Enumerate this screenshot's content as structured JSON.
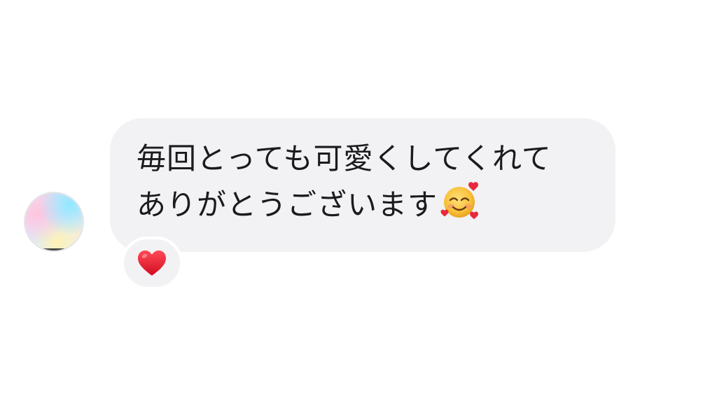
{
  "message": {
    "line1": "毎回とっても可愛くしてくれて",
    "line2": "ありがとうございます",
    "emoji": "smiling-face-with-hearts-icon"
  },
  "reaction": {
    "emoji": "red-heart-icon"
  },
  "colors": {
    "bubble": "#f2f2f4",
    "text": "#1b1b1d",
    "heart": "#e0152b"
  }
}
